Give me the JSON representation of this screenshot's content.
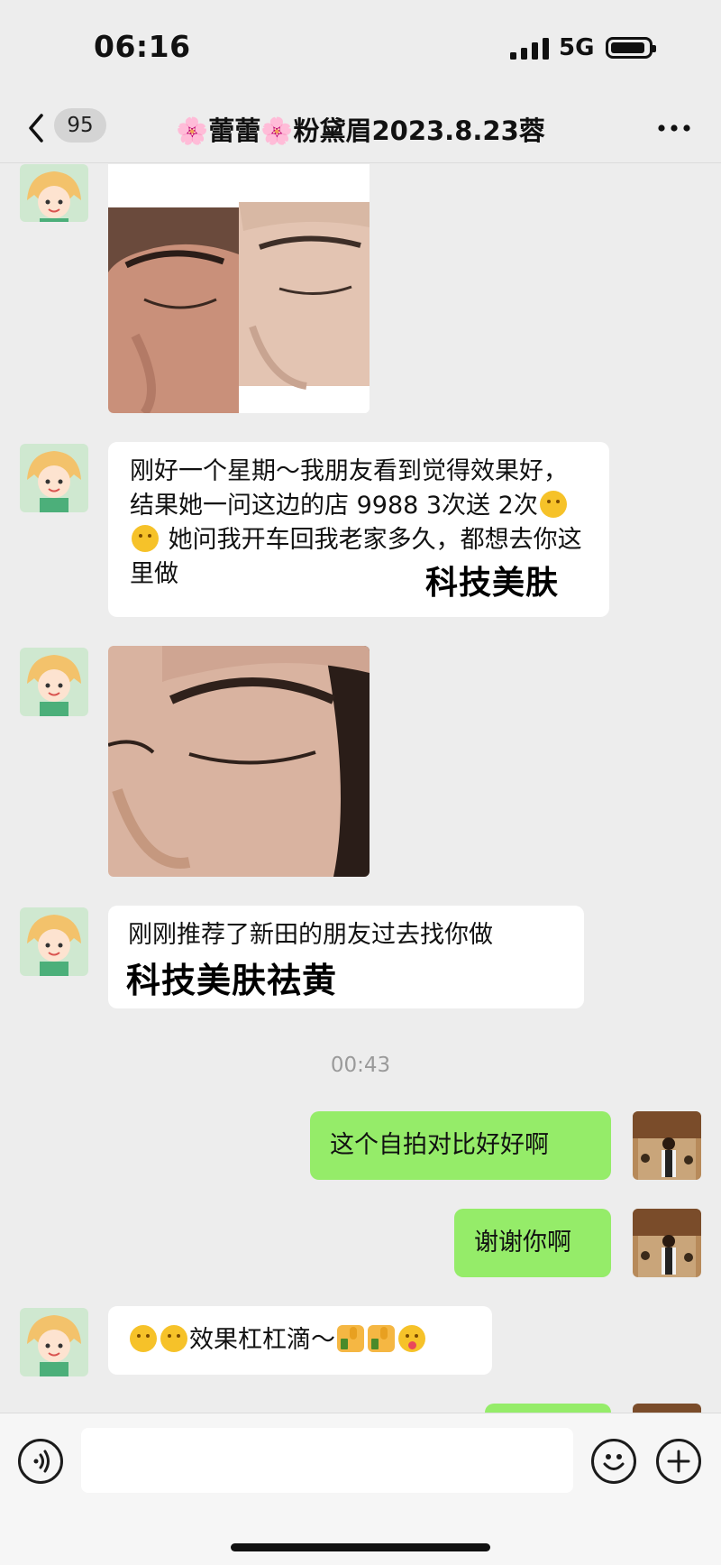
{
  "status_bar": {
    "time": "06:16",
    "network": "5G",
    "battery_level": 0.92,
    "signal_bars": 4
  },
  "nav": {
    "back_badge": "95",
    "title": "🌸蕾蕾🌸粉黛眉2023.8.23蓉"
  },
  "messages": {
    "m1_text": "刚好一个星期～我朋友看到觉得效果好，结果她一问这边的店 9988 3次送 2次",
    "m1_text_tail": " 她问我开车回我老家多久，都想去你这里做",
    "m1_overlay": "科技美肤",
    "m2_text": "刚刚推荐了新田的朋友过去找你做",
    "m2_overlay": "科技美肤祛黄",
    "timestamp": "00:43",
    "m3_text": "这个自拍对比好好啊",
    "m4_text": "谢谢你啊",
    "m5_text": "效果杠杠滴～"
  },
  "icons": {
    "back": "chevron-left-icon",
    "more": "more-dots-icon",
    "voice": "voice-icon",
    "emoji": "emoji-icon",
    "add": "plus-icon"
  },
  "colors": {
    "outgoing_bubble": "#95ec69",
    "incoming_bubble": "#ffffff",
    "background": "#ededed"
  }
}
